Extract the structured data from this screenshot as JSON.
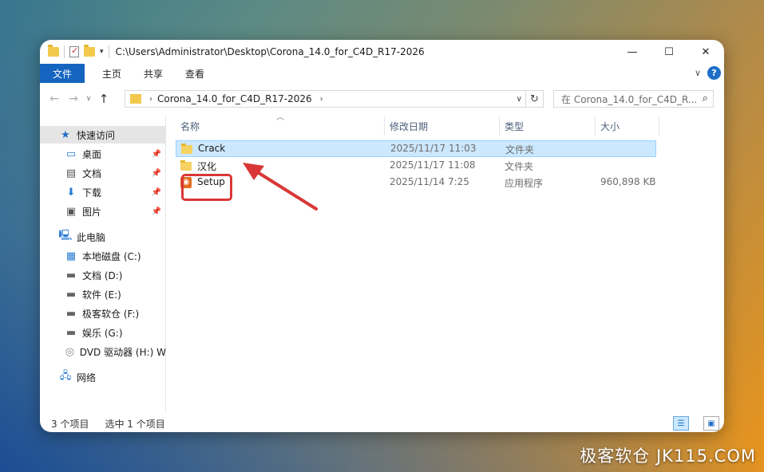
{
  "window": {
    "path": "C:\\Users\\Administrator\\Desktop\\Corona_14.0_for_C4D_R17-2026",
    "minimize": "—",
    "maximize": "☐",
    "close": "✕"
  },
  "ribbon": {
    "tabs": [
      "文件",
      "主页",
      "共享",
      "查看"
    ],
    "help": "?"
  },
  "nav": {
    "breadcrumb": "Corona_14.0_for_C4D_R17-2026",
    "search_placeholder": "在 Corona_14.0_for_C4D_R..."
  },
  "sidebar": {
    "quick_access": "快速访问",
    "quick_items": [
      "桌面",
      "文档",
      "下载",
      "图片"
    ],
    "this_pc": "此电脑",
    "drives": [
      "本地磁盘 (C:)",
      "文档 (D:)",
      "软件 (E:)",
      "极客软仓 (F:)",
      "娱乐 (G:)",
      "DVD 驱动器 (H:) W"
    ],
    "network": "网络"
  },
  "columns": [
    "名称",
    "修改日期",
    "类型",
    "大小"
  ],
  "files": [
    {
      "name": "Crack",
      "date": "2025/11/17 11:03",
      "type": "文件夹",
      "size": "",
      "icon": "folder-icon",
      "selected": true
    },
    {
      "name": "汉化",
      "date": "2025/11/17 11:08",
      "type": "文件夹",
      "size": "",
      "icon": "folder-icon",
      "selected": false
    },
    {
      "name": "Setup",
      "date": "2025/11/14 7:25",
      "type": "应用程序",
      "size": "960,898 KB",
      "icon": "app-icon",
      "selected": false
    }
  ],
  "status": {
    "count": "3 个项目",
    "selection": "选中 1 个项目"
  },
  "watermark": "极客软仓 JK115.COM",
  "colors": {
    "accent": "#1565c0",
    "selection": "#cce8ff",
    "annotation": "#d93737"
  }
}
